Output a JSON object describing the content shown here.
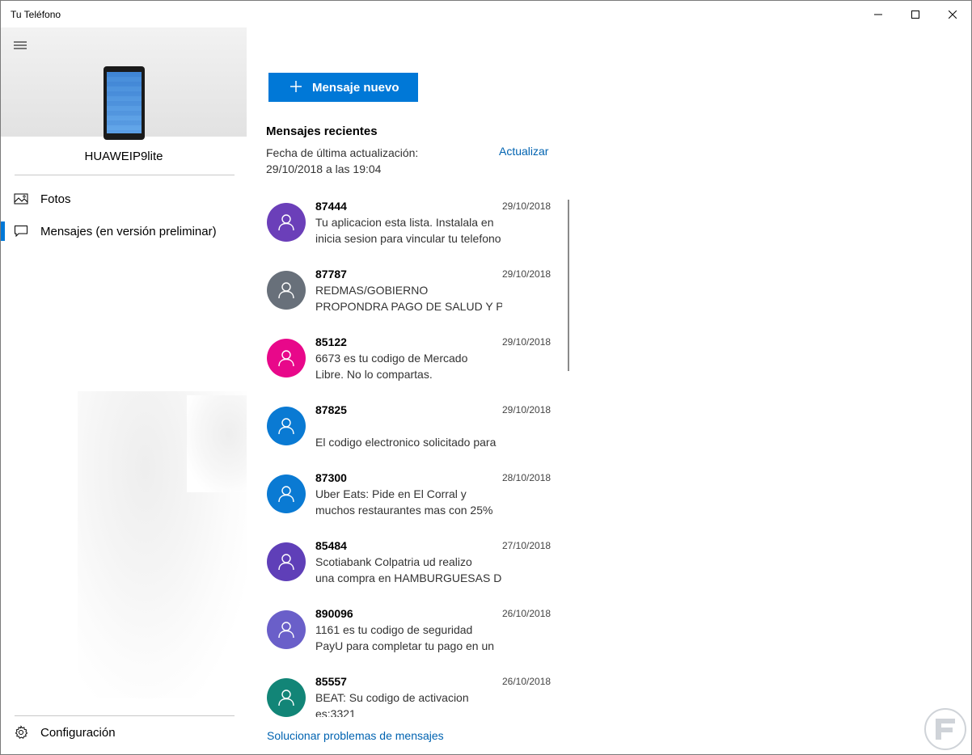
{
  "window": {
    "title": "Tu Teléfono"
  },
  "sidebar": {
    "device_name": "HUAWEIP9lite",
    "items": [
      {
        "label": "Fotos",
        "icon": "photos-icon",
        "selected": false
      },
      {
        "label": "Mensajes (en versión preliminar)",
        "icon": "message-icon",
        "selected": true
      }
    ],
    "settings_label": "Configuración"
  },
  "main": {
    "new_message_label": "Mensaje nuevo",
    "recent_heading": "Mensajes recientes",
    "last_update_label": "Fecha de última actualización:",
    "last_update_value": "29/10/2018 a las 19:04",
    "refresh_label": "Actualizar",
    "messages": [
      {
        "sender": "87444",
        "date": "29/10/2018",
        "line1": "Tu aplicacion esta lista. Instalala en",
        "line2": "inicia sesion para vincular tu telefono",
        "color": "#6b3fb9"
      },
      {
        "sender": "87787",
        "date": "29/10/2018",
        "line1": "REDMAS/GOBIERNO",
        "line2": "PROPONDRA PAGO DE SALUD Y PENSION",
        "color": "#68707a"
      },
      {
        "sender": "85122",
        "date": "29/10/2018",
        "line1": "6673 es tu codigo de Mercado",
        "line2": "Libre. No lo compartas.",
        "color": "#e8088a"
      },
      {
        "sender": "87825",
        "date": "29/10/2018",
        "line1": "",
        "line2": "El codigo electronico solicitado para",
        "color": "#0a7ad3"
      },
      {
        "sender": "87300",
        "date": "28/10/2018",
        "line1": "Uber Eats: Pide en El Corral y",
        "line2": "muchos restaurantes mas con 25%",
        "color": "#0a7ad3"
      },
      {
        "sender": "85484",
        "date": "27/10/2018",
        "line1": "Scotiabank Colpatria ud realizo",
        "line2": "una compra en HAMBURGUESAS DE",
        "color": "#5f3fb8"
      },
      {
        "sender": "890096",
        "date": "26/10/2018",
        "line1": "1161 es tu codigo de seguridad",
        "line2": "PayU para completar tu pago en un",
        "color": "#6a5fc9"
      },
      {
        "sender": "85557",
        "date": "26/10/2018",
        "line1": "BEAT: Su codigo de activacion",
        "line2": "es:3321",
        "color": "#128577"
      }
    ],
    "troubleshoot_label": "Solucionar problemas de mensajes"
  },
  "colors": {
    "accent": "#0078d7",
    "link": "#0063b1"
  }
}
